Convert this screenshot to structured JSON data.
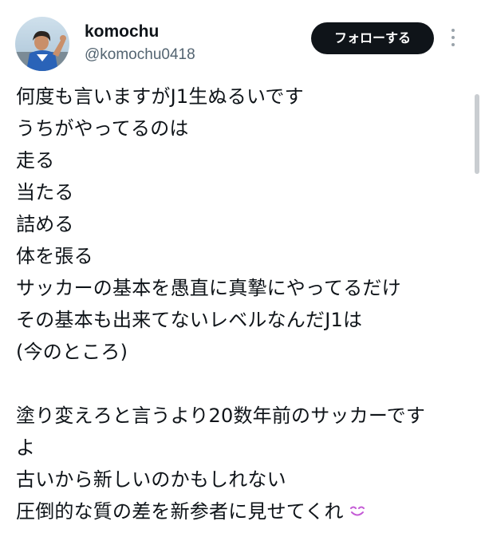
{
  "user": {
    "display_name": "komochu",
    "handle": "@komochu0418"
  },
  "follow_button": {
    "label": "フォローする"
  },
  "post": {
    "lines": [
      "何度も言いますがJ1生ぬるいです",
      "うちがやってるのは",
      "走る",
      "当たる",
      "詰める",
      "体を張る",
      "サッカーの基本を愚直に真摯にやってるだけ",
      "その基本も出来てないレベルなんだJ1は",
      "(今のところ)",
      "",
      "塗り変えろと言うより20数年前のサッカーです",
      "よ",
      "古いから新しいのかもしれない",
      "圧倒的な質の差を新参者に見せてくれ"
    ],
    "trailing_emoji": "smiling-face-icon"
  },
  "colors": {
    "button_bg": "#0f1419",
    "handle": "#536471",
    "emoji": "#c45bd6"
  }
}
